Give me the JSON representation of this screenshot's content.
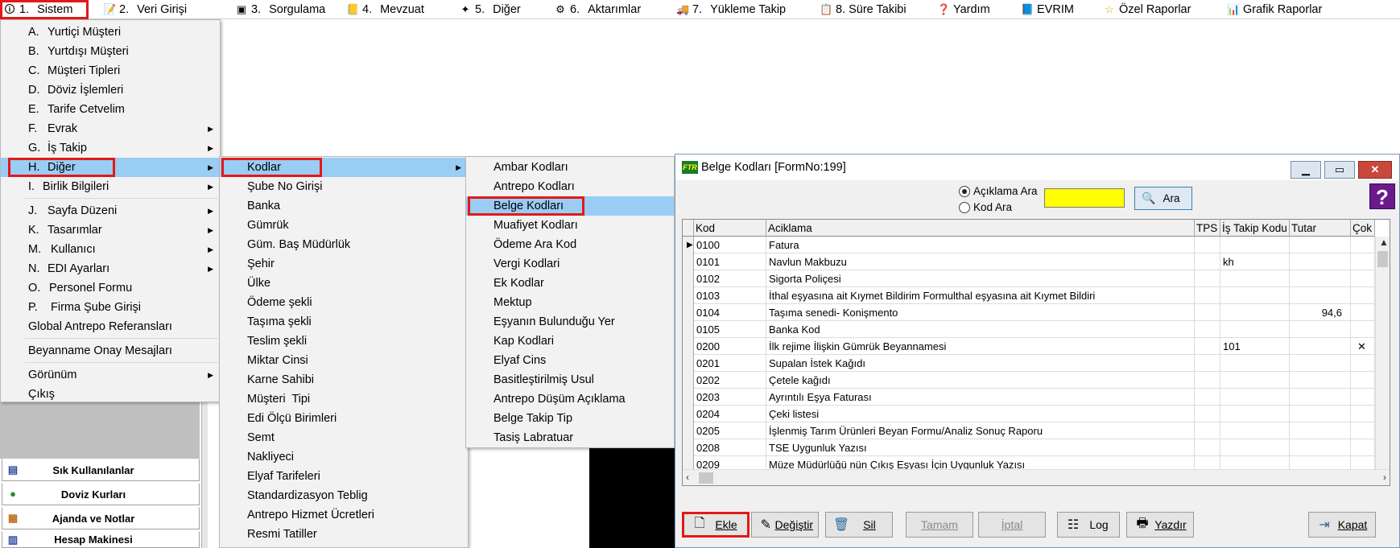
{
  "menubar": {
    "items": [
      {
        "num": "1.",
        "label": "Sistem",
        "icon": "person-icon"
      },
      {
        "num": "2.",
        "label": "Veri Girişi",
        "icon": "edit-icon"
      },
      {
        "num": "3.",
        "label": "Sorgulama",
        "icon": "query-icon"
      },
      {
        "num": "4.",
        "label": "Mevzuat",
        "icon": "law-icon"
      },
      {
        "num": "5.",
        "label": "Diğer",
        "icon": "misc-icon"
      },
      {
        "num": "6.",
        "label": "Aktarımlar",
        "icon": "transfer-icon"
      },
      {
        "num": "7.",
        "label": "Yükleme Takip",
        "icon": "truck-icon"
      },
      {
        "num": "",
        "label": "8. Süre Takibi",
        "icon": "calendar-icon"
      },
      {
        "num": "",
        "label": "Yardım",
        "icon": "help-icon"
      },
      {
        "num": "",
        "label": "EVRIM",
        "icon": "book-icon"
      },
      {
        "num": "",
        "label": "Özel Raporlar",
        "icon": "star-icon"
      },
      {
        "num": "",
        "label": "Grafik Raporlar",
        "icon": "chart-icon"
      }
    ]
  },
  "sistem_menu": {
    "items": [
      {
        "key": "A.",
        "label": "Yurtiçi Müşteri"
      },
      {
        "key": "B.",
        "label": "Yurtdışı Müşteri"
      },
      {
        "key": "C.",
        "label": "Müşteri Tipleri"
      },
      {
        "key": "D.",
        "label": "Döviz İşlemleri"
      },
      {
        "key": "E.",
        "label": "Tarife Cetvelim"
      },
      {
        "key": "F.",
        "label": "Evrak"
      },
      {
        "key": "G.",
        "label": "İş Takip"
      },
      {
        "key": "H.",
        "label": "Diğer"
      },
      {
        "key": "I.",
        "label": "Birlik Bilgileri"
      },
      {
        "key": "J.",
        "label": "Sayfa Düzeni"
      },
      {
        "key": "K.",
        "label": "Tasarımlar"
      },
      {
        "key": "M.",
        "label": "Kullanıcı"
      },
      {
        "key": "N.",
        "label": "EDI Ayarları"
      },
      {
        "key": "O.",
        "label": "Personel Formu"
      },
      {
        "key": "P.",
        "label": "Firma Şube Girişi"
      },
      {
        "key": "",
        "label": "Global Antrepo Referansları"
      },
      {
        "key": "",
        "label": "Beyanname Onay Mesajları"
      },
      {
        "key": "",
        "label": "Görünüm"
      },
      {
        "key": "",
        "label": "Çıkış"
      }
    ]
  },
  "diger_menu": {
    "items": [
      "Kodlar",
      "Şube No Girişi",
      "Banka",
      "Gümrük",
      "Güm. Baş Müdürlük",
      "Şehir",
      "Ülke",
      "Ödeme şekli",
      "Taşıma şekli",
      "Teslim şekli",
      "Miktar Cinsi",
      "Karne Sahibi",
      "Müşteri  Tipi",
      "Edi Ölçü Birimleri",
      "Semt",
      "Nakliyeci",
      "Elyaf Tarifeleri",
      "Standardizasyon Teblig",
      "Antrepo Hizmet Ücretleri",
      "Resmi Tatiller"
    ]
  },
  "kodlar_menu": {
    "items": [
      "Ambar Kodları",
      "Antrepo Kodları",
      "Belge Kodları",
      "Muafiyet Kodları",
      "Ödeme Ara Kod",
      "Vergi Kodlari",
      "Ek Kodlar",
      "Mektup",
      "Eşyanın Bulunduğu Yer",
      "Kap Kodlari",
      "Elyaf Cins",
      "Basitleştirilmiş Usul",
      "Antrepo Düşüm Açıklama",
      "Belge Takip Tip",
      "Tasiş Labratuar"
    ]
  },
  "shortcuts": {
    "items": [
      {
        "label": "Sık Kullanılanlar",
        "icon": "favorites-icon"
      },
      {
        "label": "Doviz Kurları",
        "icon": "currency-icon"
      },
      {
        "label": "Ajanda ve Notlar",
        "icon": "agenda-icon"
      },
      {
        "label": "Hesap Makinesi",
        "icon": "calculator-icon"
      }
    ]
  },
  "window": {
    "title": "Belge Kodları [FormNo:199]",
    "app_icon_text": "FTR",
    "minimize": "▁",
    "maximize": "▭",
    "close": "✕",
    "help": "?",
    "search": {
      "radio_aciklama": "Açıklama Ara",
      "radio_kod": "Kod Ara",
      "value": "",
      "button": "Ara"
    },
    "grid": {
      "columns": [
        "Kod",
        "Aciklama",
        "TPS",
        "İş Takip Kodu",
        "Tutar",
        "Çok"
      ],
      "rows": [
        {
          "kod": "0100",
          "aciklama": "Fatura",
          "tps": "",
          "is_takip": "",
          "tutar": "",
          "cok": ""
        },
        {
          "kod": "0101",
          "aciklama": "Navlun Makbuzu",
          "tps": "",
          "is_takip": "kh",
          "tutar": "",
          "cok": ""
        },
        {
          "kod": "0102",
          "aciklama": "Sigorta Poliçesi",
          "tps": "",
          "is_takip": "",
          "tutar": "",
          "cok": ""
        },
        {
          "kod": "0103",
          "aciklama": "İthal eşyasına ait Kıymet Bildirim Formulthal eşyasına ait Kıymet Bildiri",
          "tps": "",
          "is_takip": "",
          "tutar": "",
          "cok": ""
        },
        {
          "kod": "0104",
          "aciklama": "Taşıma senedi- Konişmento",
          "tps": "",
          "is_takip": "",
          "tutar": "94,6",
          "cok": ""
        },
        {
          "kod": "0105",
          "aciklama": "Banka Kod",
          "tps": "",
          "is_takip": "",
          "tutar": "",
          "cok": ""
        },
        {
          "kod": "0200",
          "aciklama": "İlk rejime İlişkin Gümrük Beyannamesi",
          "tps": "",
          "is_takip": "101",
          "tutar": "",
          "cok": "✕"
        },
        {
          "kod": "0201",
          "aciklama": "Supalan İstek Kağıdı",
          "tps": "",
          "is_takip": "",
          "tutar": "",
          "cok": ""
        },
        {
          "kod": "0202",
          "aciklama": "Çetele kağıdı",
          "tps": "",
          "is_takip": "",
          "tutar": "",
          "cok": ""
        },
        {
          "kod": "0203",
          "aciklama": "Ayrıntılı Eşya Faturası",
          "tps": "",
          "is_takip": "",
          "tutar": "",
          "cok": ""
        },
        {
          "kod": "0204",
          "aciklama": "Çeki listesi",
          "tps": "",
          "is_takip": "",
          "tutar": "",
          "cok": ""
        },
        {
          "kod": "0205",
          "aciklama": "İşlenmiş Tarım Ürünleri Beyan Formu/Analiz Sonuç Raporu",
          "tps": "",
          "is_takip": "",
          "tutar": "",
          "cok": ""
        },
        {
          "kod": "0208",
          "aciklama": "TSE Uygunluk Yazısı",
          "tps": "",
          "is_takip": "",
          "tutar": "",
          "cok": ""
        },
        {
          "kod": "0209",
          "aciklama": "Müze Müdürlüğü nün Çıkış Eşyası İçin Uygunluk Yazısı",
          "tps": "",
          "is_takip": "",
          "tutar": "",
          "cok": ""
        }
      ]
    },
    "buttons": {
      "ekle": "Ekle",
      "degistir": "Değiştir",
      "sil": "Sil",
      "tamam": "Tamam",
      "iptal": "İptal",
      "log": "Log",
      "yazdir": "Yazdır",
      "kapat": "Kapat"
    }
  },
  "colors": {
    "highlight_border": "#e41818",
    "menu_selection": "#99cdf3",
    "search_field": "#ffff00"
  }
}
